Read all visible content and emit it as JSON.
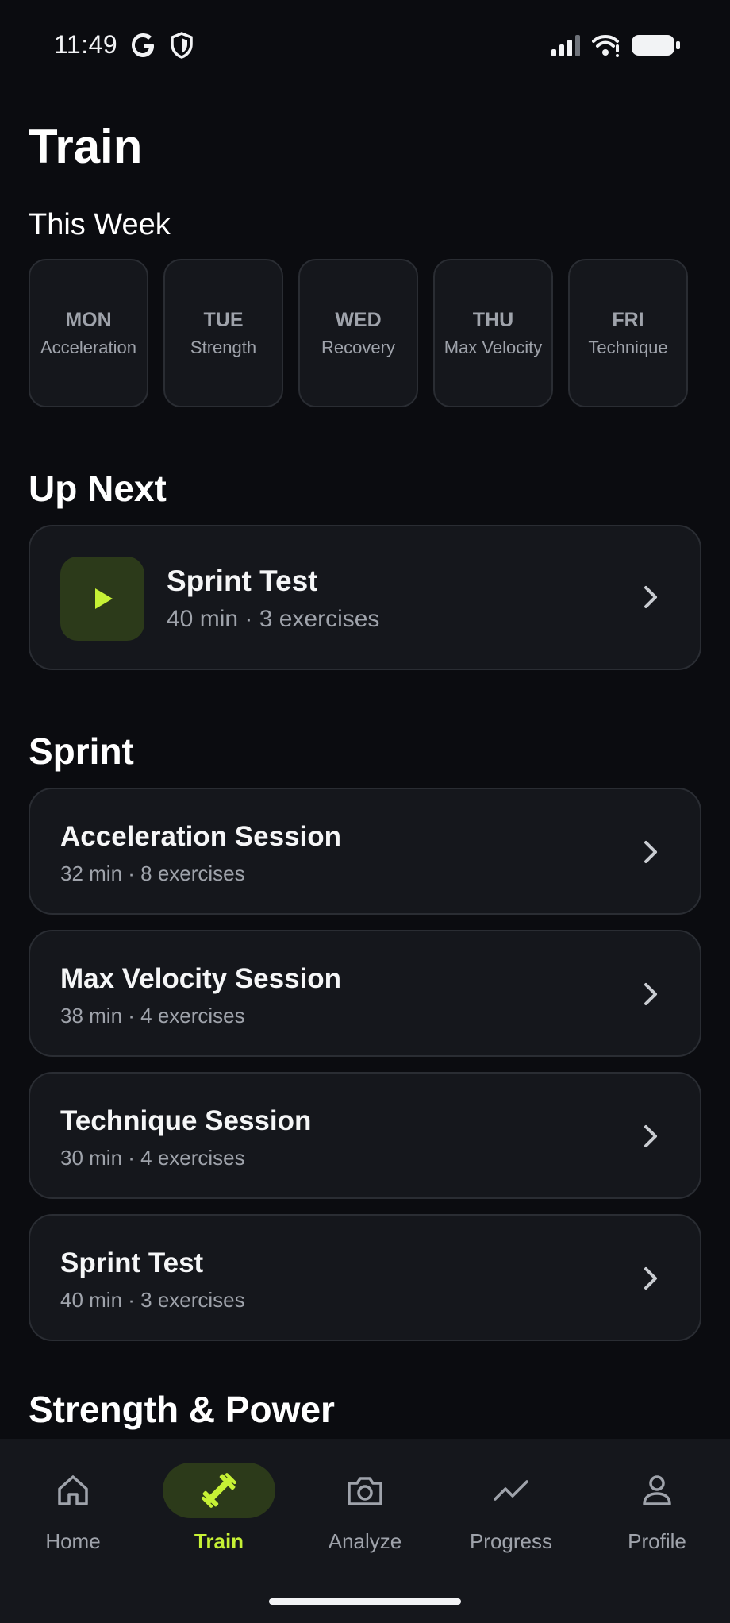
{
  "status_bar": {
    "time": "11:49"
  },
  "page": {
    "title": "Train"
  },
  "this_week": {
    "heading": "This Week",
    "days": [
      {
        "day": "MON",
        "type": "Acceleration"
      },
      {
        "day": "TUE",
        "type": "Strength"
      },
      {
        "day": "WED",
        "type": "Recovery"
      },
      {
        "day": "THU",
        "type": "Max Velocity"
      },
      {
        "day": "FRI",
        "type": "Technique"
      }
    ]
  },
  "up_next": {
    "heading": "Up Next",
    "title": "Sprint Test",
    "meta": "40 min · 3 exercises"
  },
  "sprint": {
    "heading": "Sprint",
    "sessions": [
      {
        "title": "Acceleration Session",
        "meta": "32 min · 8 exercises"
      },
      {
        "title": "Max Velocity Session",
        "meta": "38 min · 4 exercises"
      },
      {
        "title": "Technique Session",
        "meta": "30 min · 4 exercises"
      },
      {
        "title": "Sprint Test",
        "meta": "40 min · 3 exercises"
      }
    ]
  },
  "strength_power": {
    "heading": "Strength & Power"
  },
  "bottom_nav": {
    "items": [
      {
        "label": "Home",
        "icon": "home-icon"
      },
      {
        "label": "Train",
        "icon": "dumbbell-icon",
        "active": true
      },
      {
        "label": "Analyze",
        "icon": "camera-icon"
      },
      {
        "label": "Progress",
        "icon": "trending-up-icon"
      },
      {
        "label": "Profile",
        "icon": "person-icon"
      }
    ]
  },
  "colors": {
    "background": "#0b0c10",
    "card": "#15171c",
    "card_border": "#2a2d33",
    "accent": "#c6f135",
    "accent_bg": "#2c3a1a",
    "muted_text": "#9fa3ab"
  }
}
